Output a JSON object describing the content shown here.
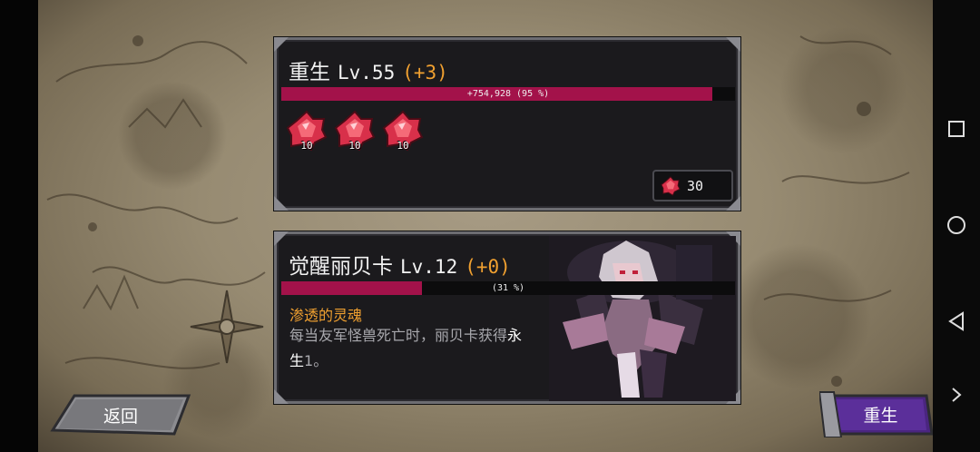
{
  "rebirth": {
    "title": "重生",
    "level": "Lv.55",
    "bonus": "(+3)",
    "xp_text": "+754,928 (95 %)",
    "xp_progress": 0.95,
    "gems": [
      {
        "icon": "red-gem-icon",
        "count": "10"
      },
      {
        "icon": "red-gem-icon",
        "count": "10"
      },
      {
        "icon": "red-gem-icon",
        "count": "10"
      }
    ],
    "cost": {
      "icon": "red-gem-icon",
      "value": "30"
    }
  },
  "hero": {
    "title": "觉醒丽贝卡",
    "level": "Lv.12",
    "bonus": "(+0)",
    "xp_text": "(31 %)",
    "xp_progress": 0.31,
    "skill_name": "渗透的灵魂",
    "skill_desc_1": "每当友军怪兽死亡时，丽贝卡获得",
    "skill_desc_hl": "永",
    "skill_desc_2_hl": "生",
    "skill_desc_2": "1。"
  },
  "buttons": {
    "back": "返回",
    "rebirth": "重生"
  },
  "colors": {
    "accent_orange": "#f0a030",
    "xp_fill": "#a3124a",
    "rebirth_button": "#5b2f9a",
    "back_button": "#8c8c90"
  },
  "system_nav": [
    "square-icon",
    "circle-icon",
    "triangle-back-icon",
    "chevron-right-icon"
  ]
}
